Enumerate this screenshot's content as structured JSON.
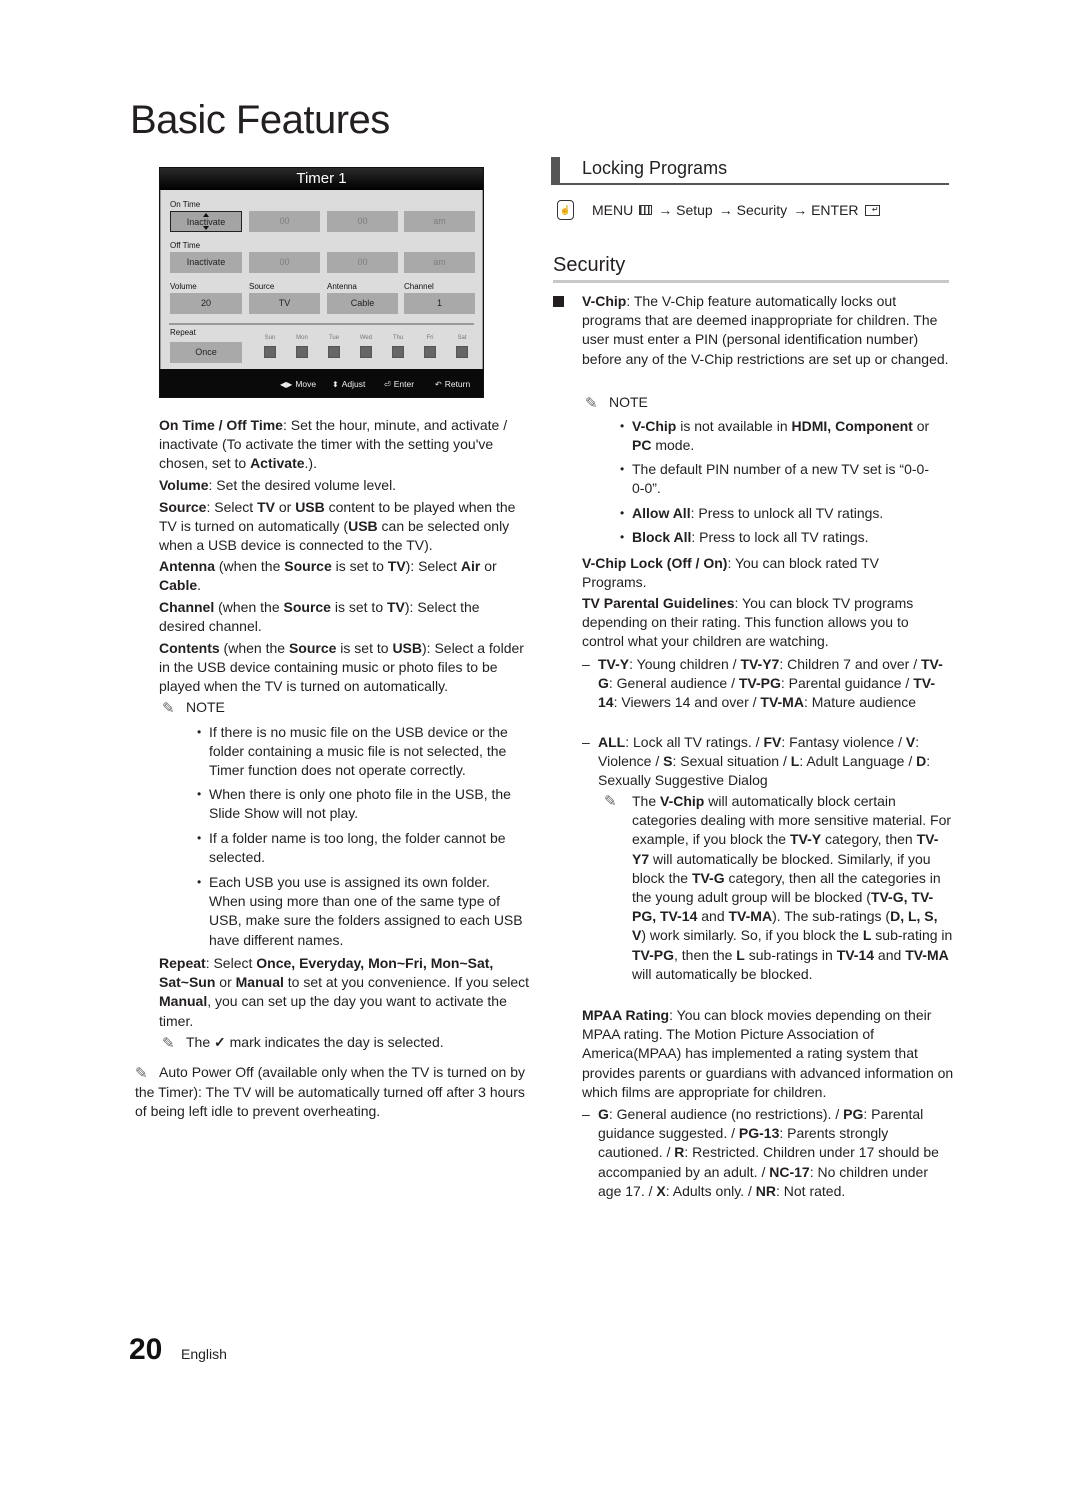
{
  "page": {
    "title": "Basic Features",
    "number": "20",
    "language": "English"
  },
  "timer": {
    "title": "Timer 1",
    "on_time": {
      "label": "On Time",
      "state": "Inactivate",
      "hour": "00",
      "minute": "00",
      "ampm": "am"
    },
    "off_time": {
      "label": "Off Time",
      "state": "Inactivate",
      "hour": "00",
      "minute": "00",
      "ampm": "am"
    },
    "fields": [
      {
        "label": "Volume",
        "value": "20"
      },
      {
        "label": "Source",
        "value": "TV"
      },
      {
        "label": "Antenna",
        "value": "Cable"
      },
      {
        "label": "Channel",
        "value": "1"
      }
    ],
    "repeat": {
      "label": "Repeat",
      "value": "Once"
    },
    "days": [
      "Sun",
      "Mon",
      "Tue",
      "Wed",
      "Thu",
      "Fri",
      "Sat"
    ],
    "footer": [
      {
        "icon": "left-right-arrows-icon",
        "label": "Move"
      },
      {
        "icon": "up-down-arrows-icon",
        "label": "Adjust"
      },
      {
        "icon": "enter-icon",
        "label": "Enter"
      },
      {
        "icon": "return-icon",
        "label": "Return"
      }
    ]
  },
  "left": {
    "on_off_time": {
      "term": "On Time / Off Time",
      "text1": ": Set the hour, minute, and activate / inactivate (To activate the timer with the setting you've chosen, set to ",
      "bold": "Activate",
      "text2": ".)."
    },
    "volume": {
      "term": "Volume",
      "text": ": Set the desired volume level."
    },
    "source": {
      "term": "Source",
      "t1": ": Select ",
      "b1": "TV",
      "t2": " or ",
      "b2": "USB",
      "t3": " content to be played when the TV is turned on automatically (",
      "b3": "USB",
      "t4": " can be selected only when a USB device is connected to the TV)."
    },
    "antenna": {
      "term": "Antenna",
      "t1": " (when the ",
      "b1": "Source",
      "t2": " is set to ",
      "b2": "TV",
      "t3": "): Select ",
      "b3": "Air",
      "t4": " or ",
      "b4": "Cable",
      "t5": "."
    },
    "channel": {
      "term": "Channel",
      "t1": " (when the ",
      "b1": "Source",
      "t2": " is set to ",
      "b2": "TV",
      "t3": "): Select the desired channel."
    },
    "contents": {
      "term": "Contents",
      "t1": " (when the ",
      "b1": "Source",
      "t2": " is set to ",
      "b2": "USB",
      "t3": "): Select a folder in the USB device containing music or photo files to be played when the TV is turned on automatically."
    },
    "note_label": "NOTE",
    "notes": [
      "If there is no music file on the USB device or the folder containing a music file is not selected, the Timer function does not operate correctly.",
      "When there is only one photo file in the USB, the Slide Show will not play.",
      "If a folder name is too long, the folder cannot be selected.",
      "Each USB you use is assigned its own folder. When using more than one of the same type of USB, make sure the folders assigned to each USB have different names."
    ],
    "repeat": {
      "term": "Repeat",
      "t1": ": Select ",
      "b1": "Once, Everyday, Mon~Fri, Mon~Sat, Sat~Sun",
      "t2": " or ",
      "b2": "Manual",
      "t3": " to set at you convenience. If you select ",
      "b3": "Manual",
      "t4": ", you can set up the day you want to activate the timer."
    },
    "check_note": {
      "t1": "The ",
      "t2": " mark indicates the day is selected."
    },
    "auto_power_off": "Auto Power Off (available only when the TV is turned on by the Timer): The TV will be automatically turned off after 3 hours of being left idle to prevent overheating."
  },
  "right": {
    "section_title": "Locking Programs",
    "menu_path": {
      "menu": "MENU",
      "a1": "→ Setup",
      "a2": "→ Security",
      "a3": "→ ENTER"
    },
    "subsection_title": "Security",
    "vchip": {
      "term": "V-Chip",
      "text": ": The V-Chip feature automatically locks out programs that are deemed inappropriate for children. The user must enter a PIN (personal identification number) before any of the V-Chip restrictions are set up or changed."
    },
    "note_label": "NOTE",
    "notes": {
      "n1": {
        "b1": "V-Chip",
        "t1": " is not available in ",
        "b2": "HDMI, Component",
        "t2": " or ",
        "b3": "PC",
        "t3": " mode."
      },
      "n2": "The default PIN number of a new TV set is “0-0-0-0”.",
      "n3": {
        "term": "Allow All",
        "text": ": Press to unlock all TV ratings."
      },
      "n4": {
        "term": "Block All",
        "text": ": Press to lock all TV ratings."
      }
    },
    "vchip_lock": {
      "term": "V-Chip Lock (Off / On)",
      "text": ": You can block rated TV Programs."
    },
    "tv_parental": {
      "term": "TV Parental Guidelines",
      "text": ": You can block TV programs depending on their rating. This function allows you to control what your children are watching."
    },
    "ratings1": [
      {
        "b": "TV-Y",
        "t": ": Young children / "
      },
      {
        "b": "TV-Y7",
        "t": ": Children 7 and over / "
      },
      {
        "b": "TV-G",
        "t": ": General audience / "
      },
      {
        "b": "TV-PG",
        "t": ": Parental guidance / "
      },
      {
        "b": "TV-14",
        "t": ": Viewers 14 and over / "
      },
      {
        "b": "TV-MA",
        "t": ": Mature audience"
      }
    ],
    "ratings2": [
      {
        "b": "ALL",
        "t": ": Lock all TV ratings. / "
      },
      {
        "b": "FV",
        "t": ": Fantasy violence / "
      },
      {
        "b": "V",
        "t": ": Violence / "
      },
      {
        "b": "S",
        "t": ": Sexual situation / "
      },
      {
        "b": "L",
        "t": ": Adult Language / "
      },
      {
        "b": "D",
        "t": ": Sexually Suggestive Dialog"
      }
    ],
    "vchip_note": [
      {
        "t": "The "
      },
      {
        "b": "V-Chip"
      },
      {
        "t": " will automatically block certain categories dealing with more sensitive material. For example, if you block the "
      },
      {
        "b": "TV-Y"
      },
      {
        "t": " category, then "
      },
      {
        "b": "TV-Y7"
      },
      {
        "t": " will automatically be blocked. Similarly, if you block the "
      },
      {
        "b": "TV-G"
      },
      {
        "t": " category, then all the categories in the young adult group will be blocked ("
      },
      {
        "b": "TV-G, TV-PG, TV-14"
      },
      {
        "t": " and "
      },
      {
        "b": "TV-MA"
      },
      {
        "t": "). The sub-ratings ("
      },
      {
        "b": "D, L, S, V"
      },
      {
        "t": ") work similarly. So, if you block the "
      },
      {
        "b": "L"
      },
      {
        "t": " sub-rating in "
      },
      {
        "b": "TV-PG"
      },
      {
        "t": ", then the "
      },
      {
        "b": "L"
      },
      {
        "t": " sub-ratings in "
      },
      {
        "b": "TV-14"
      },
      {
        "t": " and "
      },
      {
        "b": "TV-MA"
      },
      {
        "t": " will automatically be blocked."
      }
    ],
    "mpaa": {
      "term": "MPAA Rating",
      "text": ": You can block movies depending on their MPAA rating. The Motion Picture Association of America(MPAA) has implemented a rating system that provides parents or guardians with advanced information on which films are appropriate for children."
    },
    "mpaa_ratings": [
      {
        "b": "G",
        "t": ": General audience (no restrictions). / "
      },
      {
        "b": "PG",
        "t": ": Parental guidance suggested. / "
      },
      {
        "b": "PG-13",
        "t": ": Parents strongly cautioned. / "
      },
      {
        "b": "R",
        "t": ": Restricted. Children under 17 should be accompanied by an adult. / "
      },
      {
        "b": "NC-17",
        "t": ": No children under age 17. / "
      },
      {
        "b": "X",
        "t": ": Adults only. / "
      },
      {
        "b": "NR",
        "t": ": Not rated."
      }
    ]
  }
}
